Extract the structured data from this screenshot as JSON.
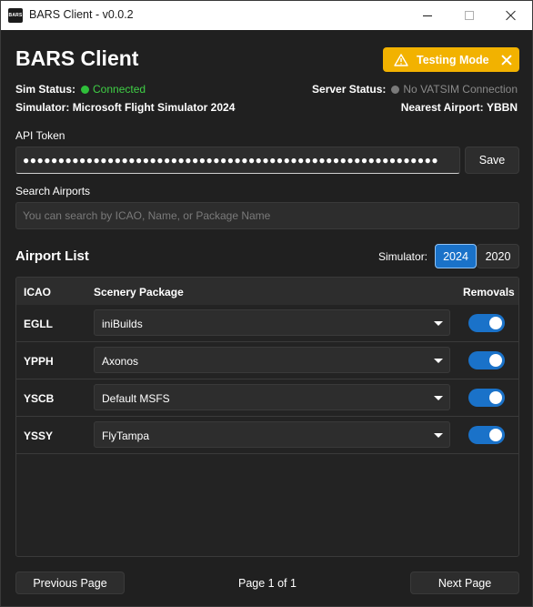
{
  "window": {
    "title": "BARS Client - v0.0.2",
    "icon_text": "BARS"
  },
  "header": {
    "app_title": "BARS Client",
    "testing_badge": "Testing Mode",
    "badge_color": "#f2b200"
  },
  "status": {
    "sim_status_label": "Sim Status:",
    "sim_status_value": "Connected",
    "sim_status_color": "#2fbf3a",
    "server_status_label": "Server Status:",
    "server_status_value": "No VATSIM Connection",
    "simulator_label": "Simulator:",
    "simulator_value": "Microsoft Flight Simulator 2024",
    "nearest_airport_label": "Nearest Airport:",
    "nearest_airport_value": "YBBN"
  },
  "api_token": {
    "label": "API Token",
    "value": "●●●●●●●●●●●●●●●●●●●●●●●●●●●●●●●●●●●●●●●●●●●●●●●●●●●●●●●●●●●",
    "save_label": "Save"
  },
  "search": {
    "label": "Search Airports",
    "placeholder": "You can search by ICAO, Name, or Package Name"
  },
  "airport_list": {
    "title": "Airport List",
    "simulator_label": "Simulator:",
    "sim_options": [
      "2024",
      "2020"
    ],
    "selected_sim": "2024",
    "accent_color": "#1a72c9",
    "columns": [
      "ICAO",
      "Scenery Package",
      "Removals"
    ],
    "rows": [
      {
        "icao": "EGLL",
        "package": "iniBuilds",
        "removals": true
      },
      {
        "icao": "YPPH",
        "package": "Axonos",
        "removals": true
      },
      {
        "icao": "YSCB",
        "package": "Default MSFS",
        "removals": true
      },
      {
        "icao": "YSSY",
        "package": "FlyTampa",
        "removals": true
      }
    ]
  },
  "pagination": {
    "prev_label": "Previous Page",
    "page_info": "Page 1 of 1",
    "next_label": "Next Page"
  }
}
